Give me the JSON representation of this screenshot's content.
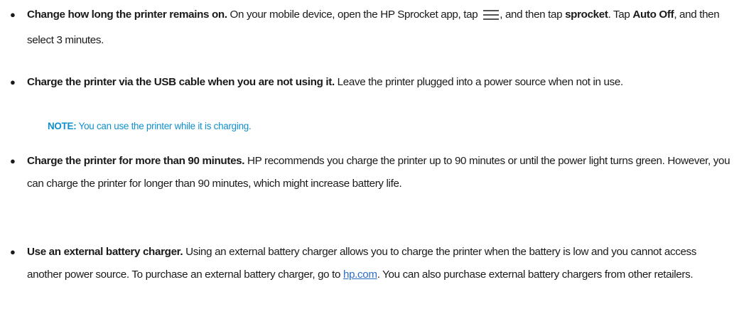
{
  "items": [
    {
      "lead": "Change how long the printer remains on.",
      "text_before_icon": " On your mobile device, open the HP Sprocket app, tap ",
      "icon": "hamburger-menu-icon",
      "text_after_icon": ", and then tap ",
      "b1": "sprocket",
      "t2": ". Tap ",
      "b2": "Auto Off",
      "t3": ", and then select 3 minutes."
    },
    {
      "lead": "Charge the printer via the USB cable when you are not using it.",
      "text": " Leave the printer plugged into a power source when not in use."
    },
    {
      "lead": "Charge the printer for more than 90 minutes.",
      "text": " HP recommends you charge the printer up to 90 minutes or until the power light turns green. However, you can charge the printer for longer than 90 minutes, which might increase battery life."
    },
    {
      "lead": "Use an external battery charger.",
      "text_before_link": " Using an external battery charger allows you to charge the printer when the battery is low and you cannot access another power source. To purchase an external battery charger, go to ",
      "link": "hp.com",
      "text_after_link": ". You can also purchase external battery chargers from other retailers."
    }
  ],
  "note": {
    "label": "NOTE:",
    "text": " You can use the printer while it is charging."
  },
  "colors": {
    "note": "#0e8fce",
    "link": "#2c6ec4",
    "text": "#1a1a1a"
  }
}
